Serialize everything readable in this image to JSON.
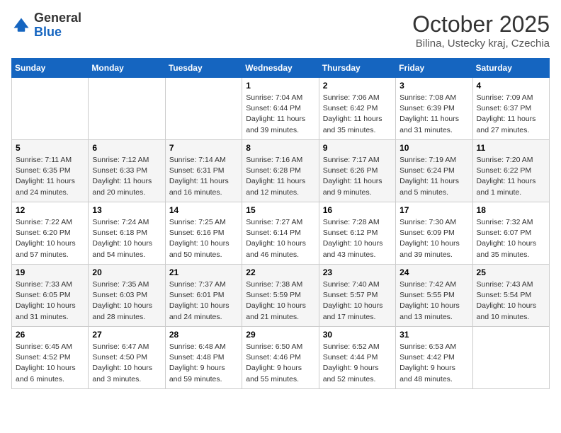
{
  "header": {
    "logo_general": "General",
    "logo_blue": "Blue",
    "title": "October 2025",
    "subtitle": "Bilina, Ustecky kraj, Czechia"
  },
  "days_of_week": [
    "Sunday",
    "Monday",
    "Tuesday",
    "Wednesday",
    "Thursday",
    "Friday",
    "Saturday"
  ],
  "weeks": [
    [
      {
        "day": "",
        "info": ""
      },
      {
        "day": "",
        "info": ""
      },
      {
        "day": "",
        "info": ""
      },
      {
        "day": "1",
        "info": "Sunrise: 7:04 AM\nSunset: 6:44 PM\nDaylight: 11 hours and 39 minutes."
      },
      {
        "day": "2",
        "info": "Sunrise: 7:06 AM\nSunset: 6:42 PM\nDaylight: 11 hours and 35 minutes."
      },
      {
        "day": "3",
        "info": "Sunrise: 7:08 AM\nSunset: 6:39 PM\nDaylight: 11 hours and 31 minutes."
      },
      {
        "day": "4",
        "info": "Sunrise: 7:09 AM\nSunset: 6:37 PM\nDaylight: 11 hours and 27 minutes."
      }
    ],
    [
      {
        "day": "5",
        "info": "Sunrise: 7:11 AM\nSunset: 6:35 PM\nDaylight: 11 hours and 24 minutes."
      },
      {
        "day": "6",
        "info": "Sunrise: 7:12 AM\nSunset: 6:33 PM\nDaylight: 11 hours and 20 minutes."
      },
      {
        "day": "7",
        "info": "Sunrise: 7:14 AM\nSunset: 6:31 PM\nDaylight: 11 hours and 16 minutes."
      },
      {
        "day": "8",
        "info": "Sunrise: 7:16 AM\nSunset: 6:28 PM\nDaylight: 11 hours and 12 minutes."
      },
      {
        "day": "9",
        "info": "Sunrise: 7:17 AM\nSunset: 6:26 PM\nDaylight: 11 hours and 9 minutes."
      },
      {
        "day": "10",
        "info": "Sunrise: 7:19 AM\nSunset: 6:24 PM\nDaylight: 11 hours and 5 minutes."
      },
      {
        "day": "11",
        "info": "Sunrise: 7:20 AM\nSunset: 6:22 PM\nDaylight: 11 hours and 1 minute."
      }
    ],
    [
      {
        "day": "12",
        "info": "Sunrise: 7:22 AM\nSunset: 6:20 PM\nDaylight: 10 hours and 57 minutes."
      },
      {
        "day": "13",
        "info": "Sunrise: 7:24 AM\nSunset: 6:18 PM\nDaylight: 10 hours and 54 minutes."
      },
      {
        "day": "14",
        "info": "Sunrise: 7:25 AM\nSunset: 6:16 PM\nDaylight: 10 hours and 50 minutes."
      },
      {
        "day": "15",
        "info": "Sunrise: 7:27 AM\nSunset: 6:14 PM\nDaylight: 10 hours and 46 minutes."
      },
      {
        "day": "16",
        "info": "Sunrise: 7:28 AM\nSunset: 6:12 PM\nDaylight: 10 hours and 43 minutes."
      },
      {
        "day": "17",
        "info": "Sunrise: 7:30 AM\nSunset: 6:09 PM\nDaylight: 10 hours and 39 minutes."
      },
      {
        "day": "18",
        "info": "Sunrise: 7:32 AM\nSunset: 6:07 PM\nDaylight: 10 hours and 35 minutes."
      }
    ],
    [
      {
        "day": "19",
        "info": "Sunrise: 7:33 AM\nSunset: 6:05 PM\nDaylight: 10 hours and 31 minutes."
      },
      {
        "day": "20",
        "info": "Sunrise: 7:35 AM\nSunset: 6:03 PM\nDaylight: 10 hours and 28 minutes."
      },
      {
        "day": "21",
        "info": "Sunrise: 7:37 AM\nSunset: 6:01 PM\nDaylight: 10 hours and 24 minutes."
      },
      {
        "day": "22",
        "info": "Sunrise: 7:38 AM\nSunset: 5:59 PM\nDaylight: 10 hours and 21 minutes."
      },
      {
        "day": "23",
        "info": "Sunrise: 7:40 AM\nSunset: 5:57 PM\nDaylight: 10 hours and 17 minutes."
      },
      {
        "day": "24",
        "info": "Sunrise: 7:42 AM\nSunset: 5:55 PM\nDaylight: 10 hours and 13 minutes."
      },
      {
        "day": "25",
        "info": "Sunrise: 7:43 AM\nSunset: 5:54 PM\nDaylight: 10 hours and 10 minutes."
      }
    ],
    [
      {
        "day": "26",
        "info": "Sunrise: 6:45 AM\nSunset: 4:52 PM\nDaylight: 10 hours and 6 minutes."
      },
      {
        "day": "27",
        "info": "Sunrise: 6:47 AM\nSunset: 4:50 PM\nDaylight: 10 hours and 3 minutes."
      },
      {
        "day": "28",
        "info": "Sunrise: 6:48 AM\nSunset: 4:48 PM\nDaylight: 9 hours and 59 minutes."
      },
      {
        "day": "29",
        "info": "Sunrise: 6:50 AM\nSunset: 4:46 PM\nDaylight: 9 hours and 55 minutes."
      },
      {
        "day": "30",
        "info": "Sunrise: 6:52 AM\nSunset: 4:44 PM\nDaylight: 9 hours and 52 minutes."
      },
      {
        "day": "31",
        "info": "Sunrise: 6:53 AM\nSunset: 4:42 PM\nDaylight: 9 hours and 48 minutes."
      },
      {
        "day": "",
        "info": ""
      }
    ]
  ]
}
